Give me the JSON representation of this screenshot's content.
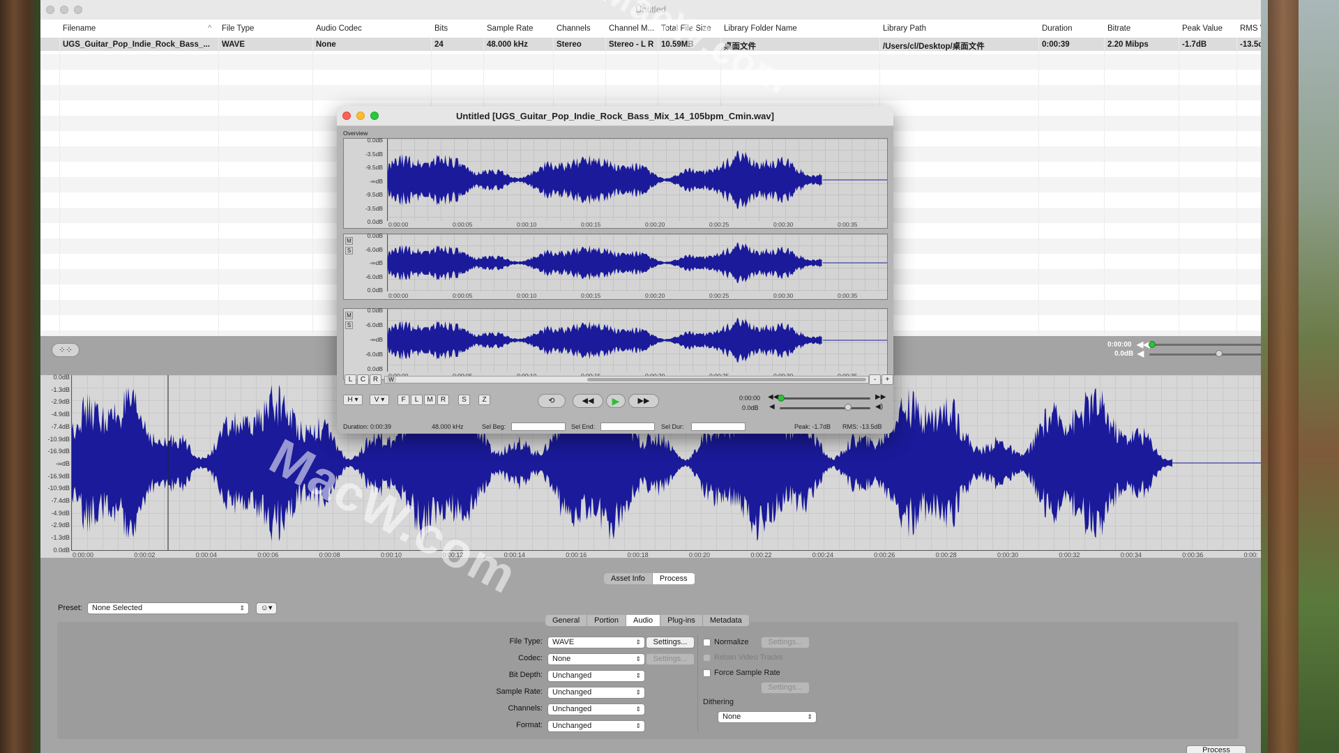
{
  "window": {
    "title": "Untitled"
  },
  "library": {
    "columns": [
      "Filename",
      "File Type",
      "Audio Codec",
      "Bits",
      "Sample Rate",
      "Channels",
      "Channel M...",
      "Total File Size",
      "Library Folder Name",
      "Library Path",
      "Duration",
      "Bitrate",
      "Peak Value",
      "RMS V"
    ],
    "row": [
      "UGS_Guitar_Pop_Indie_Rock_Bass_...",
      "WAVE",
      "None",
      "24",
      "48.000 kHz",
      "Stereo",
      "Stereo - L R",
      "10.59MB",
      "桌面文件",
      "/Users/cl/Desktop/桌面文件",
      "0:00:39",
      "2.20 Mibps",
      "-1.7dB",
      "-13.5d"
    ]
  },
  "transport_mini": {
    "time": "0:00:00",
    "gain": "0.0dB",
    "waveform_label": "⁘⁘"
  },
  "main_wave": {
    "ylabels": [
      "0.0dB",
      "-1.3dB",
      "-2.9dB",
      "-4.9dB",
      "-7.4dB",
      "-10.9dB",
      "-16.9dB",
      "-∞dB",
      "-16.9dB",
      "-10.9dB",
      "-7.4dB",
      "-4.9dB",
      "-2.9dB",
      "-1.3dB",
      "0.0dB"
    ],
    "xlabels": [
      "0:00:00",
      "0:00:02",
      "0:00:04",
      "0:00:06",
      "0:00:08",
      "0:00:10",
      "0:00:12",
      "0:00:14",
      "0:00:16",
      "0:00:18",
      "0:00:20",
      "0:00:22",
      "0:00:24",
      "0:00:26",
      "0:00:28",
      "0:00:30",
      "0:00:32",
      "0:00:34",
      "0:00:36",
      "0:00:"
    ]
  },
  "audio_window": {
    "title": "Untitled [UGS_Guitar_Pop_Indie_Rock_Bass_Mix_14_105bpm_Cmin.wav]",
    "overview_label": "Overview",
    "overview_ylabels": [
      "0.0dB",
      "-3.5dB",
      "-9.5dB",
      "-∞dB",
      "-9.5dB",
      "-3.5dB",
      "0.0dB"
    ],
    "channel_ylabels": [
      "0.0dB",
      "-6.0dB",
      "-∞dB",
      "-6.0dB",
      "0.0dB"
    ],
    "xlabels": [
      "0:00:00",
      "0:00:05",
      "0:00:10",
      "0:00:15",
      "0:00:20",
      "0:00:25",
      "0:00:30",
      "0:00:35"
    ],
    "lcr": [
      "L",
      "C",
      "R"
    ],
    "w_label": "W",
    "minus": "-",
    "plus": "+",
    "h_label": "H",
    "v_label": "V",
    "flmr": [
      "F",
      "L",
      "M",
      "R"
    ],
    "s_label": "S",
    "z_label": "Z",
    "ms_m": "M",
    "ms_s": "S",
    "time": "0:00:00",
    "gain": "0.0dB",
    "duration": "Duration: 0:00:39",
    "rate": "48.000 kHz",
    "sel_beg": "Sel Beg:",
    "sel_end": "Sel End:",
    "sel_dur": "Sel Dur:",
    "peak": "Peak: -1.7dB",
    "rms": "RMS: -13.5dB"
  },
  "bottom": {
    "tabs": [
      "Asset Info",
      "Process"
    ],
    "preset_label": "Preset:",
    "preset_value": "None Selected",
    "subtabs": [
      "General",
      "Portion",
      "Audio",
      "Plug-ins",
      "Metadata"
    ],
    "labels": [
      "File Type:",
      "Codec:",
      "Bit Depth:",
      "Sample Rate:",
      "Channels:",
      "Format:"
    ],
    "values": [
      "WAVE",
      "None",
      "Unchanged",
      "Unchanged",
      "Unchanged",
      "Unchanged"
    ],
    "settings": "Settings...",
    "normalize": "Normalize",
    "retain": "Retain Video Tracks",
    "force": "Force Sample Rate",
    "dithering": "Dithering",
    "dither_value": "None",
    "process_button": "Process"
  },
  "colors": {
    "wave": "#1a1a9a",
    "accent_green": "#2fbf3a"
  }
}
